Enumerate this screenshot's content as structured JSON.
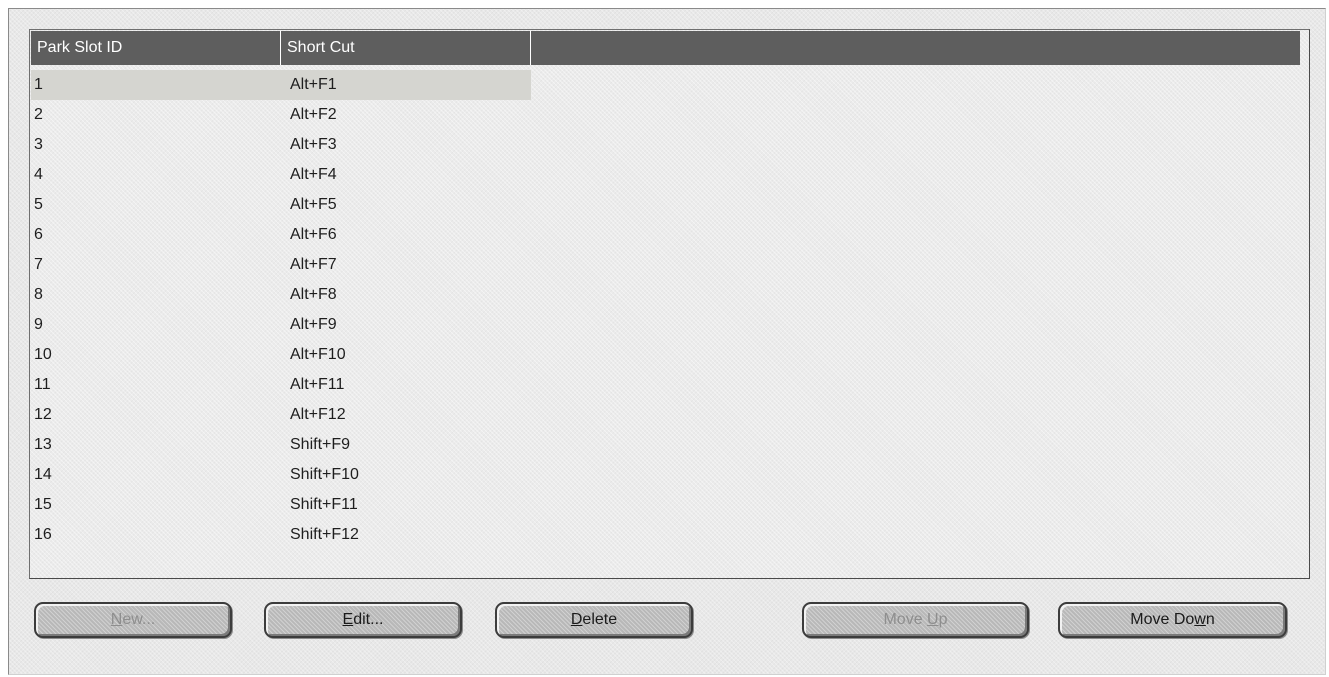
{
  "table": {
    "columns": [
      "Park Slot ID",
      "Short Cut",
      ""
    ],
    "rows": [
      {
        "id": "1",
        "shortcut": "Alt+F1",
        "selected": true
      },
      {
        "id": "2",
        "shortcut": "Alt+F2"
      },
      {
        "id": "3",
        "shortcut": "Alt+F3"
      },
      {
        "id": "4",
        "shortcut": "Alt+F4"
      },
      {
        "id": "5",
        "shortcut": "Alt+F5"
      },
      {
        "id": "6",
        "shortcut": "Alt+F6"
      },
      {
        "id": "7",
        "shortcut": "Alt+F7"
      },
      {
        "id": "8",
        "shortcut": "Alt+F8"
      },
      {
        "id": "9",
        "shortcut": "Alt+F9"
      },
      {
        "id": "10",
        "shortcut": "Alt+F10"
      },
      {
        "id": "11",
        "shortcut": "Alt+F11"
      },
      {
        "id": "12",
        "shortcut": "Alt+F12"
      },
      {
        "id": "13",
        "shortcut": "Shift+F9"
      },
      {
        "id": "14",
        "shortcut": "Shift+F10"
      },
      {
        "id": "15",
        "shortcut": "Shift+F11"
      },
      {
        "id": "16",
        "shortcut": "Shift+F12"
      }
    ]
  },
  "buttons": {
    "new": {
      "label": "New...",
      "mnemonic": "N",
      "enabled": false
    },
    "edit": {
      "label": "Edit...",
      "mnemonic": "E",
      "enabled": true
    },
    "delete": {
      "label": "Delete",
      "mnemonic": "D",
      "enabled": true
    },
    "move_up": {
      "label": "Move Up",
      "mnemonic": "U",
      "enabled": false
    },
    "move_down": {
      "label": "Move Down",
      "mnemonic": "w",
      "enabled": true
    }
  },
  "colors": {
    "header_bg": "#5e5e5e",
    "selected_row_bg": "#d5d5d0",
    "disabled_text": "#8e8e8e"
  }
}
